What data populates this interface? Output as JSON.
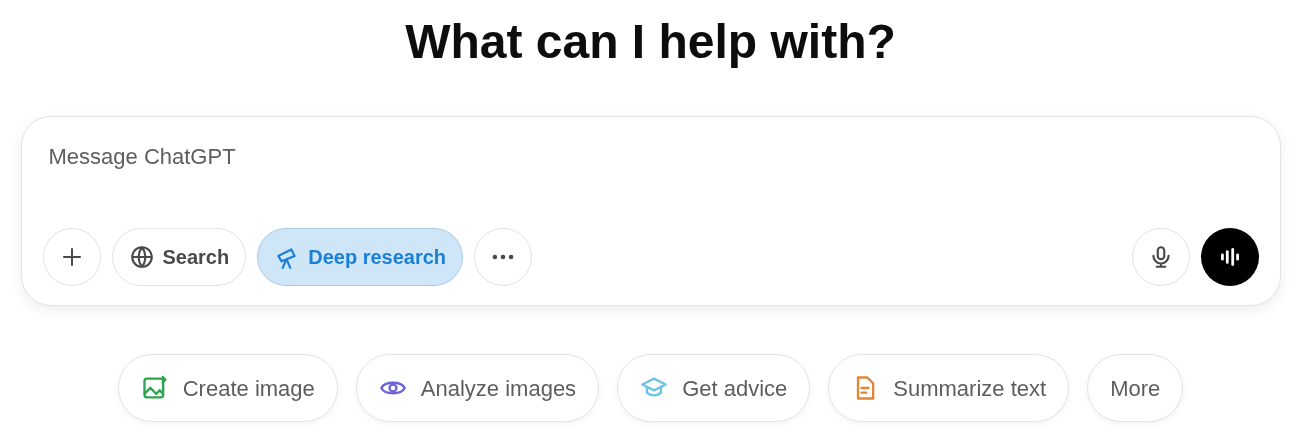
{
  "heading": "What can I help with?",
  "composer": {
    "placeholder": "Message ChatGPT",
    "tools": [
      {
        "kind": "add",
        "selected": false
      },
      {
        "kind": "search",
        "label": "Search",
        "selected": false
      },
      {
        "kind": "research",
        "label": "Deep research",
        "selected": true
      },
      {
        "kind": "more",
        "selected": false
      }
    ],
    "actions": [
      {
        "kind": "mic"
      },
      {
        "kind": "voice"
      }
    ]
  },
  "suggestions": [
    {
      "kind": "image",
      "label": "Create image",
      "color": "#2ea44f"
    },
    {
      "kind": "eye",
      "label": "Analyze images",
      "color": "#6c63d9"
    },
    {
      "kind": "cap",
      "label": "Get advice",
      "color": "#6cc3e6"
    },
    {
      "kind": "doc",
      "label": "Summarize text",
      "color": "#e0873a"
    },
    {
      "label": "More"
    }
  ]
}
